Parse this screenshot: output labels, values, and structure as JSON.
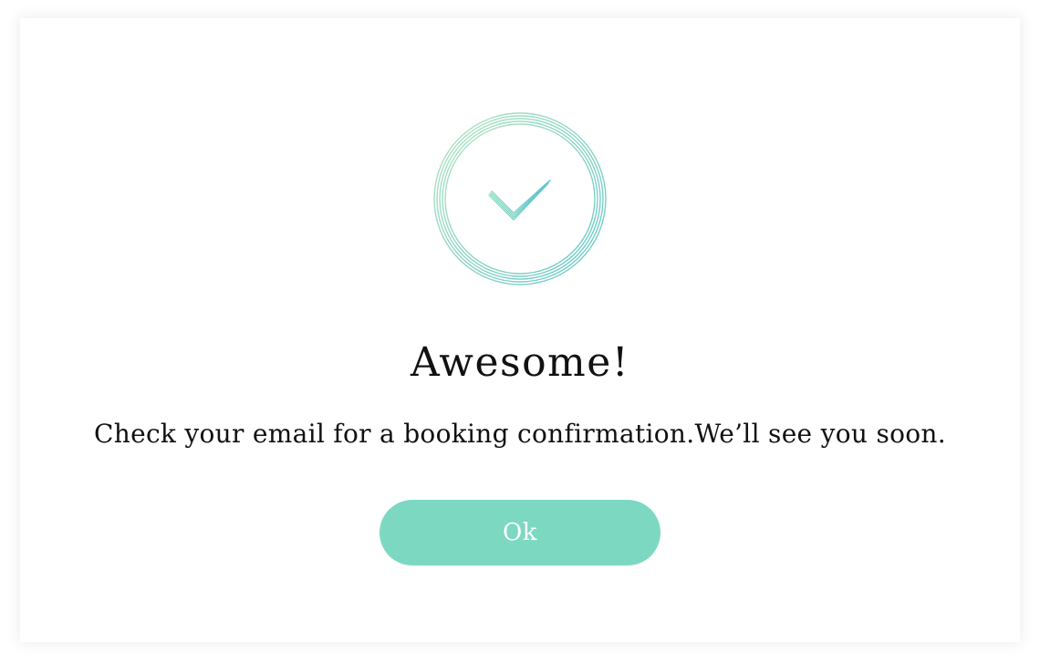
{
  "dialog": {
    "icon": "check-circle-icon",
    "title": "Awesome!",
    "message": "Check your email for a booking confirmation.We’ll see you soon.",
    "ok_label": "Ok"
  },
  "colors": {
    "accent": "#7dd8c1",
    "icon_gradient_start": "#a8e0c0",
    "icon_gradient_end": "#6cc9c6",
    "text": "#111111"
  }
}
